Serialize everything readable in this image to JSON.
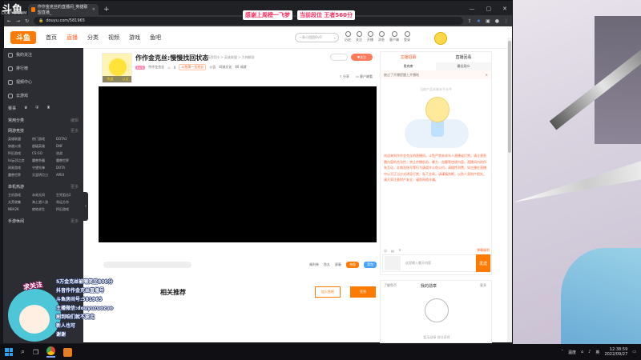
{
  "overlay": {
    "brand": "斗鱼",
    "url_caption": "DOUYU.COM",
    "banner": [
      "感谢上周榜一飞梦",
      "当前段位 王者560分"
    ]
  },
  "browser": {
    "tab_title": "作作金克丝的直播间_英雄联盟直播_",
    "address": "douyu.com/581965",
    "window_controls": [
      "—",
      "▢",
      "✕"
    ]
  },
  "site": {
    "logo": "斗鱼",
    "nav": [
      "首页",
      "直播",
      "分类",
      "视频",
      "游戏",
      "鱼吧"
    ],
    "search_placeholder": "一条小团团OvO",
    "header_icons": [
      "历史",
      "关注",
      "开播",
      "消息",
      "客户端",
      "登录"
    ]
  },
  "sidebar": {
    "items": [
      {
        "icon": "heart-icon",
        "label": "我的关注"
      },
      {
        "icon": "rank-icon",
        "label": "排行榜"
      },
      {
        "icon": "video-icon",
        "label": "视频中心"
      },
      {
        "icon": "cloud-icon",
        "label": "云游戏"
      }
    ],
    "row_label": "赛事",
    "common_title": "常用分类",
    "common_more": "编辑",
    "sections": [
      {
        "title": "网游竞技",
        "more": "更多",
        "items": [
          "英雄联盟",
          "热门游戏",
          "DOTA2",
          "穿越火线",
          "超级英雄",
          "DNF",
          "怀旧游戏",
          "CS:GO",
          "逆战",
          "lol云顶之弈",
          "魔兽争霸",
          "魔兽世界",
          "网易游戏",
          "守望先锋",
          "DOTA",
          "魔兽世界",
          "天涯明月刀",
          "APEX"
        ]
      },
      {
        "title": "单机热游",
        "more": "更多",
        "items": [
          "主机游戏",
          "永劫无间",
          "生死狙击2",
          "太荒收集",
          "海上猎人游",
          "命运方舟",
          "NBA2K",
          "绝地求生",
          "怀旧游戏"
        ]
      },
      {
        "title": "手游休闲",
        "more": "更多",
        "items": []
      }
    ]
  },
  "streamer": {
    "title": "作作金克丝:慢慢找回状态",
    "category": "网游竞技 > 英雄联盟 > 大神解说",
    "name": "作作金克丝",
    "level_badge": "Lv.6",
    "hot": "0",
    "rank": "斗鱼第一金克丝",
    "announce": "公告",
    "culture": "同城文化",
    "room_info": "80 成就",
    "ava_labels": [
      "热度",
      "认证"
    ],
    "follow_label": "关注",
    "share": "分享",
    "report": "客户端看"
  },
  "player": {
    "welfare": "福利券",
    "gift_toggle": "鱼丸",
    "shield": "屏蔽",
    "btn1": "充值",
    "btn2": "背包"
  },
  "recommend": {
    "title": "相关推荐",
    "join": "加入鱼吧",
    "sign": "签到"
  },
  "rightpanel": {
    "tabs": [
      "主播招募",
      "直播回看"
    ],
    "subtabs": [
      "贵宾席",
      "最佳观众"
    ],
    "tip": "被过了开播提醒上开播啦",
    "tip_close": "×",
    "note": "当前产品本来水平水平",
    "welcome": "欢迎来到作作金克丝的直播间。斗鱼严禁未成年人直播或打赏。请注意直播内容的合法性，禁止传播低俗、暴力、血腥等违规内容。直播间内的所有互动、礼物及账号等行为请遵守斗鱼公约。请理性消费，如主播在直播中以不正当方式诱导打赏、私下交易，请谨慎判断，以防人身财产损失。请大家注意财产安全，谨防网络诈骗。",
    "input_icons": [
      "表情",
      "弹幕",
      "字号"
    ],
    "gift_label": "弹幕福利",
    "send_placeholder": "这里输入聊天内容",
    "send_btn": "发送"
  },
  "fanspanel": {
    "left": "了解鱼币",
    "title": "我的勋章",
    "more": "更多",
    "foot": "暂无勋章 前往获得"
  },
  "obs": {
    "tag": "求关注",
    "lines": [
      "5万金克丝被嘲笑至800分",
      "抖音作作金克丝直播号",
      "斗鱼房间号:581965",
      "主播微信:douyuzuozuo",
      "刷到咱们就不要走",
      "新人也可",
      "谢谢"
    ]
  },
  "taskbar": {
    "time": "12:38:59",
    "date": "2022/09/27",
    "lang": "英",
    "extra": "温度"
  }
}
